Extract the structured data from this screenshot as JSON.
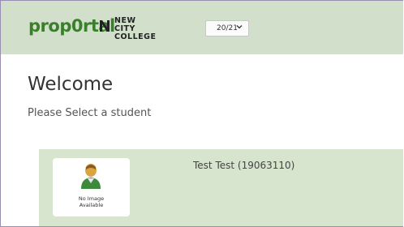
{
  "header": {
    "logo": "prop0rtal",
    "college_line1": "NEW CITY",
    "college_line2": "COLLEGE",
    "year_select": {
      "value": "20/21"
    }
  },
  "main": {
    "welcome": "Welcome",
    "subtitle": "Please Select a student"
  },
  "students": [
    {
      "name": "Test Test (19063110)",
      "photo_placeholder_line1": "No Image",
      "photo_placeholder_line2": "Available"
    }
  ],
  "colors": {
    "header_bg": "#d2dfca",
    "card_bg": "#d7e5cf",
    "brand_green": "#3a7f2a"
  }
}
